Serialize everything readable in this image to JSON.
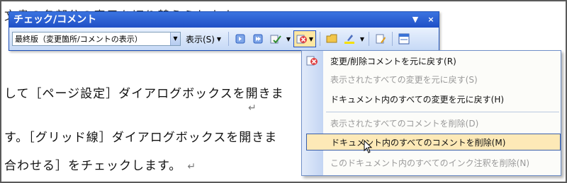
{
  "document": {
    "lines": [
      "して［ページ設定］ダイアログボックスを開きま",
      "す。［グリッド線］ダイアログボックスを開きま",
      "合わせる］をチェックします。"
    ],
    "return_mark": "↵"
  },
  "toolbar": {
    "title": "チェック/コメント",
    "display_mode": "最終版（変更箇所/コメントの表示）",
    "show_label": "表示(S)",
    "title_buttons": [
      "▼",
      "×"
    ],
    "icons": [
      "previous-change-icon",
      "next-change-icon",
      "accept-change-icon",
      "reject-change-icon",
      "insert-comment-icon",
      "highlight-icon",
      "track-changes-icon",
      "reviewing-pane-icon"
    ]
  },
  "menu": {
    "items": [
      {
        "label": "変更/削除コメントを元に戻す(R)",
        "enabled": true
      },
      {
        "label": "表示されたすべての変更を元に戻す(S)",
        "enabled": false
      },
      {
        "label": "ドキュメント内のすべての変更を元に戻す(H)",
        "enabled": true
      },
      {
        "label": "表示されたすべてのコメントを削除(D)",
        "enabled": false
      },
      {
        "label": "ドキュメント内のすべてのコメントを削除(M)",
        "enabled": true,
        "highlighted": true
      },
      {
        "label": "このドキュメント内のすべてのインク注釈を削除(N)",
        "enabled": false
      }
    ]
  },
  "colors": {
    "title_bar": "#1f4fc6",
    "toolbar_bg": "#dbe8fb",
    "menu_highlight": "#fde9b7",
    "disabled_text": "#9a9a9a"
  }
}
